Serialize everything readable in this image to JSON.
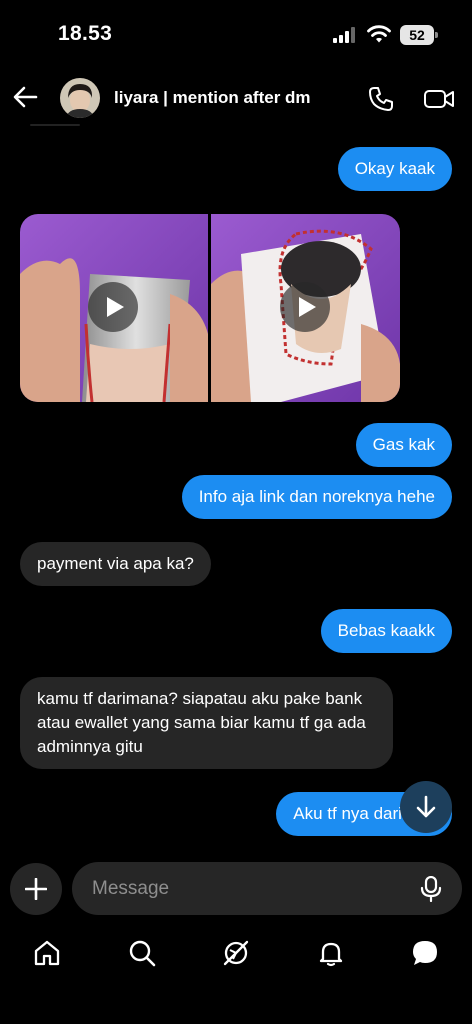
{
  "status_bar": {
    "time": "18.53",
    "battery": "52"
  },
  "header": {
    "contact_name": "liyara | mention after dm",
    "icons": [
      "back-arrow-icon",
      "phone-icon",
      "video-camera-icon"
    ]
  },
  "messages": [
    {
      "direction": "outgoing",
      "type": "text",
      "text": "Okay kaak"
    },
    {
      "direction": "incoming",
      "type": "video",
      "count": 2
    },
    {
      "direction": "outgoing",
      "type": "text",
      "text": "Gas kak"
    },
    {
      "direction": "outgoing",
      "type": "text",
      "text": "Info aja link dan noreknya hehe"
    },
    {
      "direction": "incoming",
      "type": "text",
      "text": "payment via apa ka?"
    },
    {
      "direction": "outgoing",
      "type": "text",
      "text": "Bebas kaakk"
    },
    {
      "direction": "incoming",
      "type": "text",
      "text": "kamu tf darimana? siapatau aku pake bank atau ewallet yang sama biar kamu tf ga ada adminnya gitu"
    },
    {
      "direction": "outgoing",
      "type": "text",
      "text": "Aku tf nya dari BRI"
    }
  ],
  "composer": {
    "placeholder": "Message"
  },
  "colors": {
    "outgoing_bubble": "#1c8df2",
    "incoming_bubble": "#262626",
    "background": "#000000"
  },
  "bottom_nav": {
    "items": [
      "home-icon",
      "search-icon",
      "explore-icon",
      "notifications-icon",
      "messages-icon"
    ]
  }
}
